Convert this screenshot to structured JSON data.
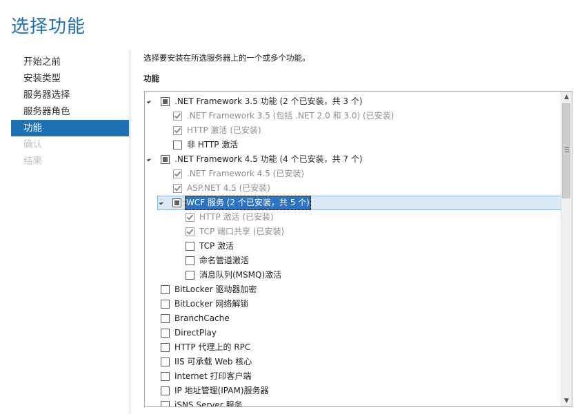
{
  "page": {
    "title": "选择功能",
    "instruction": "选择要安装在所选服务器上的一个或多个功能。",
    "section_label": "功能"
  },
  "nav": {
    "items": [
      {
        "label": "开始之前",
        "state": "normal"
      },
      {
        "label": "安装类型",
        "state": "normal"
      },
      {
        "label": "服务器选择",
        "state": "normal"
      },
      {
        "label": "服务器角色",
        "state": "normal"
      },
      {
        "label": "功能",
        "state": "active"
      },
      {
        "label": "确认",
        "state": "disabled"
      },
      {
        "label": "结果",
        "state": "disabled"
      }
    ]
  },
  "features": [
    {
      "label": ".NET Framework 3.5 功能 (2 个已安装，共 3 个)",
      "level": 0,
      "expander": true,
      "check": "indeterminate",
      "disabled": false,
      "selected": false
    },
    {
      "label": ".NET Framework 3.5 (包括 .NET 2.0 和 3.0) (已安装)",
      "level": 1,
      "expander": false,
      "check": "checked",
      "disabled": true,
      "selected": false
    },
    {
      "label": "HTTP 激活 (已安装)",
      "level": 1,
      "expander": false,
      "check": "checked",
      "disabled": true,
      "selected": false
    },
    {
      "label": "非 HTTP 激活",
      "level": 1,
      "expander": false,
      "check": "unchecked",
      "disabled": false,
      "selected": false
    },
    {
      "label": ".NET Framework 4.5 功能 (4 个已安装，共 7 个)",
      "level": 0,
      "expander": true,
      "check": "indeterminate",
      "disabled": false,
      "selected": false
    },
    {
      "label": ".NET Framework 4.5 (已安装)",
      "level": 1,
      "expander": false,
      "check": "checked",
      "disabled": true,
      "selected": false
    },
    {
      "label": "ASP.NET 4.5 (已安装)",
      "level": 1,
      "expander": false,
      "check": "checked",
      "disabled": true,
      "selected": false
    },
    {
      "label": "WCF 服务 (2 个已安装，共 5 个)",
      "level": 1,
      "expander": true,
      "check": "indeterminate",
      "disabled": false,
      "selected": true
    },
    {
      "label": "HTTP 激活 (已安装)",
      "level": 2,
      "expander": false,
      "check": "checked",
      "disabled": true,
      "selected": false
    },
    {
      "label": "TCP 端口共享 (已安装)",
      "level": 2,
      "expander": false,
      "check": "checked",
      "disabled": true,
      "selected": false
    },
    {
      "label": "TCP 激活",
      "level": 2,
      "expander": false,
      "check": "unchecked",
      "disabled": false,
      "selected": false
    },
    {
      "label": "命名管道激活",
      "level": 2,
      "expander": false,
      "check": "unchecked",
      "disabled": false,
      "selected": false
    },
    {
      "label": "消息队列(MSMQ)激活",
      "level": 2,
      "expander": false,
      "check": "unchecked",
      "disabled": false,
      "selected": false
    },
    {
      "label": "BitLocker 驱动器加密",
      "level": 0,
      "expander": false,
      "check": "unchecked",
      "disabled": false,
      "selected": false
    },
    {
      "label": "BitLocker 网络解锁",
      "level": 0,
      "expander": false,
      "check": "unchecked",
      "disabled": false,
      "selected": false
    },
    {
      "label": "BranchCache",
      "level": 0,
      "expander": false,
      "check": "unchecked",
      "disabled": false,
      "selected": false
    },
    {
      "label": "DirectPlay",
      "level": 0,
      "expander": false,
      "check": "unchecked",
      "disabled": false,
      "selected": false
    },
    {
      "label": "HTTP 代理上的 RPC",
      "level": 0,
      "expander": false,
      "check": "unchecked",
      "disabled": false,
      "selected": false
    },
    {
      "label": "IIS 可承载 Web 核心",
      "level": 0,
      "expander": false,
      "check": "unchecked",
      "disabled": false,
      "selected": false
    },
    {
      "label": "Internet 打印客户端",
      "level": 0,
      "expander": false,
      "check": "unchecked",
      "disabled": false,
      "selected": false
    },
    {
      "label": "IP 地址管理(IPAM)服务器",
      "level": 0,
      "expander": false,
      "check": "unchecked",
      "disabled": false,
      "selected": false
    },
    {
      "label": "iSNS Server 服务",
      "level": 0,
      "expander": false,
      "check": "unchecked",
      "disabled": false,
      "selected": false
    }
  ],
  "scrollbar": {
    "up_icon": "chevron-up-icon",
    "down_icon": "chevron-down-icon"
  }
}
